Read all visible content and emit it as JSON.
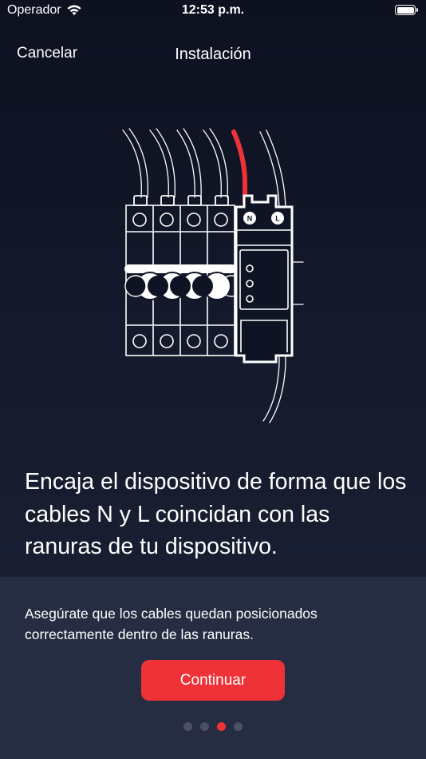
{
  "status_bar": {
    "carrier": "Operador",
    "time": "12:53 p.m."
  },
  "nav": {
    "cancel_label": "Cancelar",
    "title": "Instalación"
  },
  "illustration": {
    "terminal_n": "N",
    "terminal_l": "L",
    "live_wire_color": "#ee3237"
  },
  "content": {
    "main_text": "Encaja el dispositivo de forma que los cables N y L coincidan con las ranuras de tu dispositivo.",
    "hint_text": "Asegúrate que los cables quedan posicionados correctamente dentro de las ranuras."
  },
  "actions": {
    "continue_label": "Continuar"
  },
  "pagination": {
    "total": 4,
    "current": 3
  },
  "colors": {
    "accent": "#ee3237",
    "panel": "#262c41",
    "dot_inactive": "#4a5066"
  }
}
